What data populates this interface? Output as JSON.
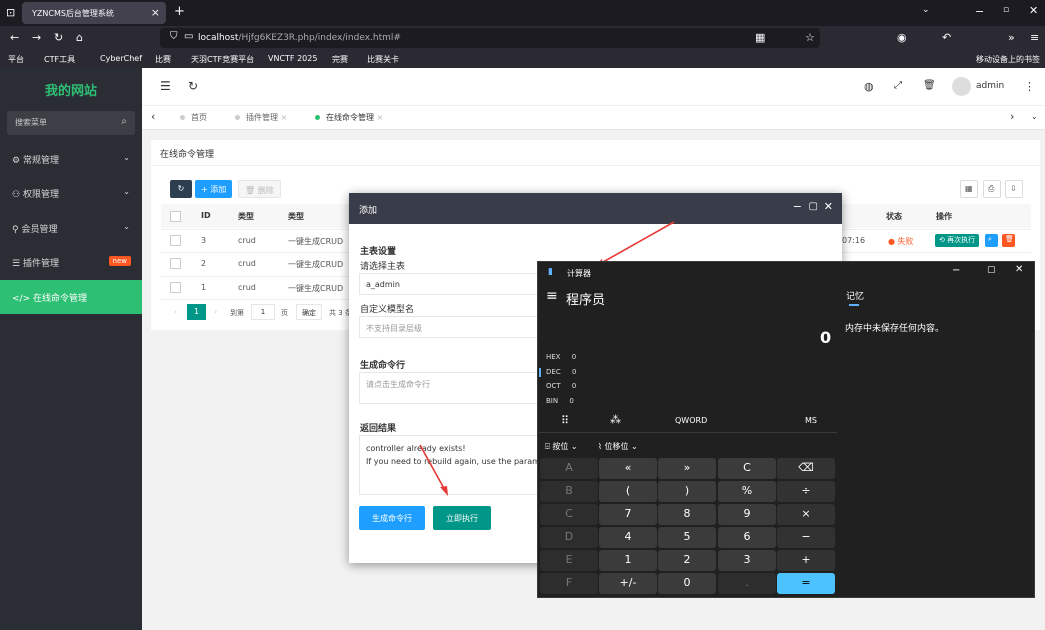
{
  "browser": {
    "tab_title": "YZNCMS后台管理系统",
    "url_host": "localhost",
    "url_path": "/Hjfg6KEZ3R.php/index/index.html#",
    "bookmarks": [
      "平台",
      "CTF工具",
      "CyberChef",
      "比赛",
      "天羽CTF竞赛平台",
      "VNCTF 2025",
      "完赛",
      "比赛关卡"
    ],
    "mobile_bookmarks": "移动设备上的书签"
  },
  "sidebar": {
    "logo": "我的网站",
    "search_placeholder": "搜索菜单",
    "items": [
      {
        "label": "常规管理"
      },
      {
        "label": "权限管理"
      },
      {
        "label": "会员管理"
      },
      {
        "label": "插件管理",
        "badge": "new"
      },
      {
        "label": "在线命令管理"
      }
    ]
  },
  "header": {
    "user": "admin"
  },
  "tabs": [
    {
      "label": "首页"
    },
    {
      "label": "插件管理"
    },
    {
      "label": "在线命令管理"
    }
  ],
  "panel": {
    "title": "在线命令管理",
    "add_label": "添加",
    "delete_label": "删除",
    "columns": [
      "ID",
      "类型",
      "类型",
      "状态",
      "操作"
    ],
    "rows": [
      {
        "id": "3",
        "type": "crud",
        "desc": "一键生成CRUD",
        "time": "07:16",
        "status": "失败"
      },
      {
        "id": "2",
        "type": "crud",
        "desc": "一键生成CRUD"
      },
      {
        "id": "1",
        "type": "crud",
        "desc": "一键生成CRUD"
      }
    ],
    "rerun_label": "再次执行",
    "pager": {
      "page": "1",
      "goto_label": "到第",
      "page_unit": "页",
      "confirm": "确定",
      "total": "共 3 条"
    }
  },
  "dialog": {
    "title": "添加",
    "section_main": "主表设置",
    "select_main_label": "请选择主表",
    "main_table_value": "a_admin",
    "custom_model_label": "自定义模型名",
    "custom_model_placeholder": "不支持目录层级",
    "gen_cmd_label": "生成命令行",
    "gen_cmd_placeholder": "请点击生成命令行",
    "result_label": "返回结果",
    "result_line1": "controller already exists!",
    "result_line2": "If you need to rebuild again, use the paramet",
    "btn_generate": "生成命令行",
    "btn_execute": "立即执行"
  },
  "calculator": {
    "window_title": "计算器",
    "mode": "程序员",
    "memory_tab": "记忆",
    "memory_empty": "内存中未保存任何内容。",
    "display": "0",
    "radix": [
      {
        "name": "HEX",
        "value": "0"
      },
      {
        "name": "DEC",
        "value": "0"
      },
      {
        "name": "OCT",
        "value": "0"
      },
      {
        "name": "BIN",
        "value": "0"
      }
    ],
    "word_size": "QWORD",
    "ms": "MS",
    "bitwise": "按位",
    "bitshift": "位移位",
    "keys": [
      [
        "A",
        "«",
        "»",
        "C",
        "⌫"
      ],
      [
        "B",
        "(",
        ")",
        "%",
        "÷"
      ],
      [
        "C",
        "7",
        "8",
        "9",
        "×"
      ],
      [
        "D",
        "4",
        "5",
        "6",
        "−"
      ],
      [
        "E",
        "1",
        "2",
        "3",
        "+"
      ],
      [
        "F",
        "+/-",
        "0",
        ".",
        "="
      ]
    ]
  }
}
